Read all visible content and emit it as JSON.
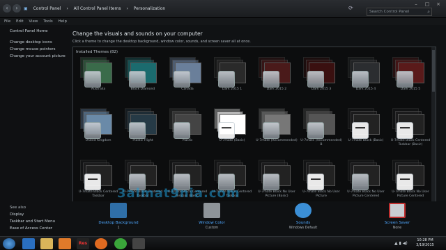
{
  "address_bar": {
    "crumbs": [
      "Control Panel",
      "All Control Panel Items",
      "Personalization"
    ],
    "search_placeholder": "Search Control Panel"
  },
  "menu": [
    "File",
    "Edit",
    "View",
    "Tools",
    "Help"
  ],
  "leftnav": {
    "home": "Control Panel Home",
    "links": [
      "Change desktop icons",
      "Change mouse pointers",
      "Change your account picture"
    ],
    "see_also": "See also",
    "see_links": [
      "Display",
      "Taskbar and Start Menu",
      "Ease of Access Center"
    ]
  },
  "main": {
    "title": "Change the visuals and sounds on your computer",
    "subtitle": "Click a theme to change the desktop background, window color, sounds, and screen saver all at once.",
    "installed_label": "Installed Themes (82)"
  },
  "themes": [
    {
      "name": "Australia",
      "kind": "photo",
      "color": "#3a6b4a"
    },
    {
      "name": "Black Diamond",
      "kind": "photo",
      "color": "#1b6b6e"
    },
    {
      "name": "Canada",
      "kind": "photo",
      "color": "#6a7f9a"
    },
    {
      "name": "Dark 2015 1",
      "kind": "photo",
      "color": "#2a2a2a"
    },
    {
      "name": "Dark 2015 2",
      "kind": "photo",
      "color": "#4a1a1a"
    },
    {
      "name": "Dark 2015 3",
      "kind": "photo",
      "color": "#3a1010"
    },
    {
      "name": "Dark 2015 4",
      "kind": "photo",
      "color": "#2b2d30"
    },
    {
      "name": "Dark 2015 5",
      "kind": "photo",
      "color": "#5a1a1a"
    },
    {
      "name": "United Kingdom",
      "kind": "photo",
      "color": "#6a8aa8"
    },
    {
      "name": "Plastic Flight",
      "kind": "photo",
      "color": "#263a46"
    },
    {
      "name": "Plastic",
      "kind": "photo",
      "color": "#444"
    },
    {
      "name": "U-7mate (Basic)",
      "kind": "white",
      "color": "#fff"
    },
    {
      "name": "U-7mate (Recommended)",
      "kind": "plain",
      "color": "#777"
    },
    {
      "name": "U-7mate (Recommended) B",
      "kind": "plain",
      "color": "#555"
    },
    {
      "name": "U-7mate Black (Basic)",
      "kind": "white",
      "color": "#222"
    },
    {
      "name": "U-7mate Black Centered Taskbar (Basic)",
      "kind": "white",
      "color": "#222"
    },
    {
      "name": "U-7mate Black Centered Taskbar",
      "kind": "white",
      "color": "#222"
    },
    {
      "name": "U-7mate Black Centered Taskbar",
      "kind": "plain",
      "color": "#222"
    },
    {
      "name": "U-7mate Black Centered Taskbar (Basic)",
      "kind": "plain",
      "color": "#222"
    },
    {
      "name": "U-7mate Black Centered Taskbar",
      "kind": "plain",
      "color": "#222"
    },
    {
      "name": "U-7mate Black No User Picture (Basic)",
      "kind": "plain",
      "color": "#222"
    },
    {
      "name": "U-7mate Black No User Picture",
      "kind": "white",
      "color": "#222"
    },
    {
      "name": "U-7mate Black No User Picture Centered",
      "kind": "plain",
      "color": "#222"
    },
    {
      "name": "U-7mate Black No User Picture Centered",
      "kind": "white",
      "color": "#222"
    }
  ],
  "options": [
    {
      "label": "Desktop Background",
      "sub": "1",
      "color": "#2f6fa8"
    },
    {
      "label": "Window Color",
      "sub": "Custom",
      "color": "#8e9499"
    },
    {
      "label": "Sounds",
      "sub": "Windows Default",
      "color": "#3b8fd6"
    },
    {
      "label": "Screen Saver",
      "sub": "None",
      "color": "#c03030"
    }
  ],
  "watermark": "3almat9nia.com",
  "taskbar": {
    "apps": [
      "start",
      "ie",
      "explorer",
      "media",
      "res",
      "firefox",
      "utorrent",
      "app"
    ],
    "time": "10:28 PM",
    "date": "3/19/2015"
  }
}
